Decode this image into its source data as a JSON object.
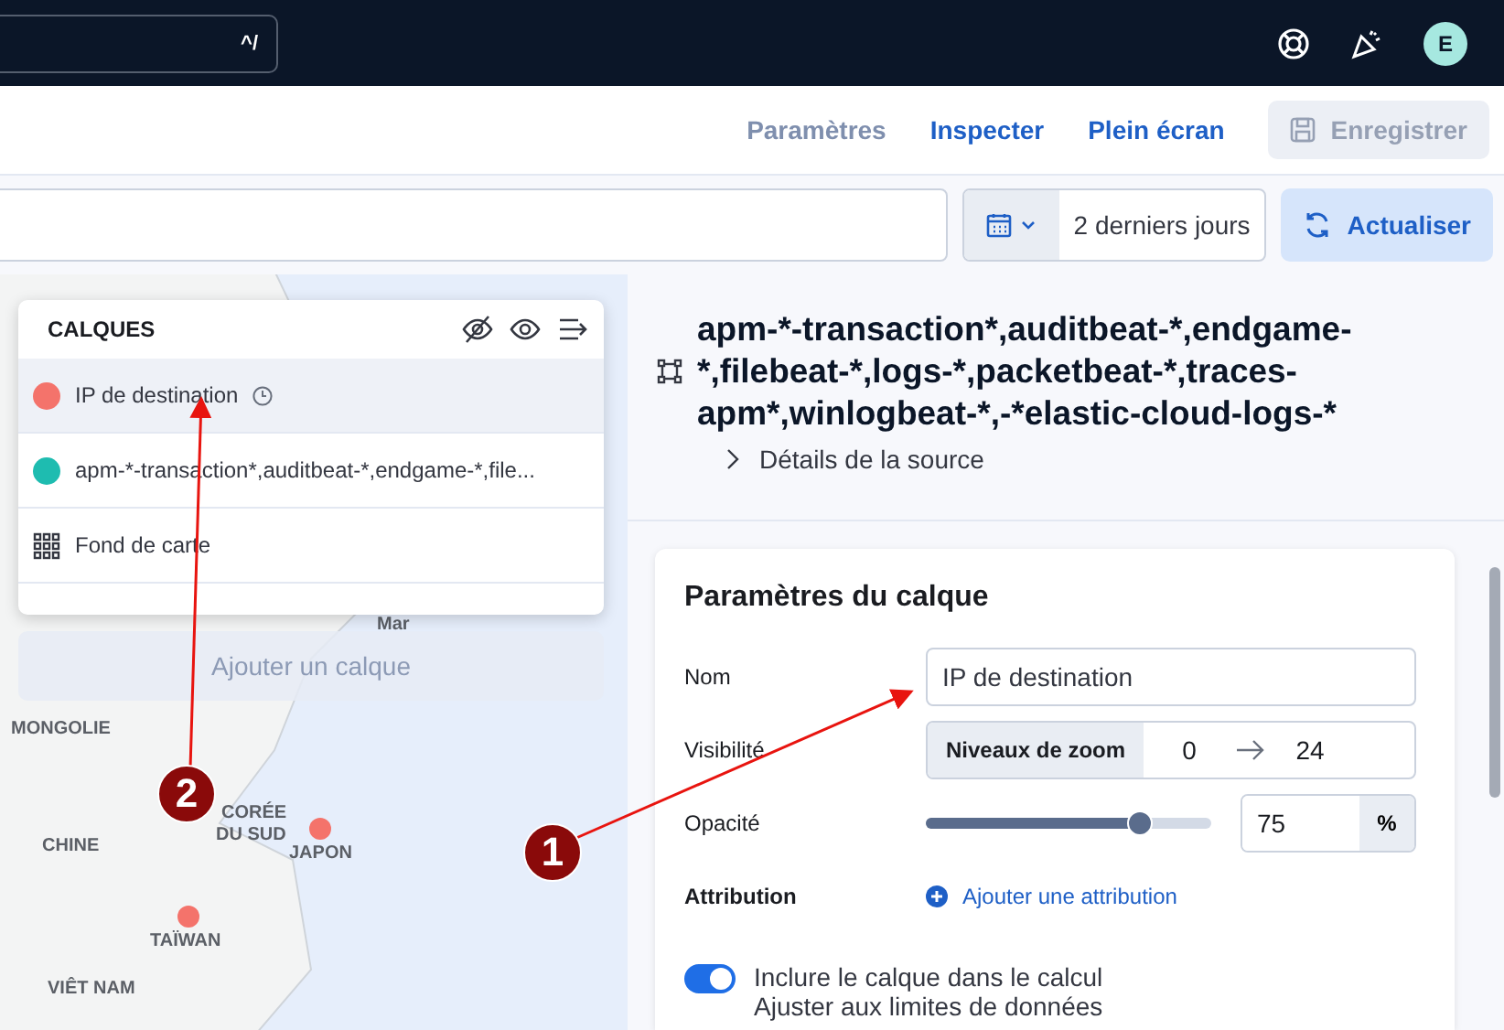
{
  "top_bar": {
    "search_shortcut": "^/",
    "avatar_initial": "E"
  },
  "header": {
    "links": [
      {
        "label": "Paramètres",
        "disabled": true
      },
      {
        "label": "Inspecter",
        "disabled": false
      },
      {
        "label": "Plein écran",
        "disabled": false
      }
    ],
    "save_button": {
      "label": "Enregistrer",
      "disabled": true
    }
  },
  "query_bar": {
    "date_range": "2 derniers jours",
    "refresh_button": "Actualiser"
  },
  "layers_panel": {
    "title": "CALQUES",
    "layers": [
      {
        "kind": "point",
        "name": "IP de destination",
        "color": "#f4736b",
        "selected": true,
        "time_filtered": true
      },
      {
        "kind": "point",
        "name": "apm-*-transaction*,auditbeat-*,endgame-*,file...",
        "color": "#1ebcb0",
        "selected": false,
        "time_filtered": false
      },
      {
        "kind": "basemap",
        "name": "Fond de carte",
        "selected": false,
        "time_filtered": false
      }
    ],
    "add_layer_button": "Ajouter un calque"
  },
  "map": {
    "labels": [
      "Mar",
      "MONGOLIE",
      "CORÉE",
      "DU SUD",
      "CHINE",
      "JAPON",
      "TAÏWAN",
      "VIÊT NAM"
    ]
  },
  "source": {
    "title": "apm-*-transaction*,auditbeat-*,endgame-*,filebeat-*,logs-*,packetbeat-*,traces-apm*,winlogbeat-*,-*elastic-cloud-logs-*",
    "details_toggle": "Détails de la source",
    "expanded": false
  },
  "settings": {
    "title": "Paramètres du calque",
    "name": {
      "label": "Nom",
      "value": "IP de destination"
    },
    "visibility": {
      "label": "Visibilité",
      "prefix": "Niveaux de zoom",
      "min": "0",
      "max": "24"
    },
    "opacity": {
      "label": "Opacité",
      "level": 0.75,
      "value": "75",
      "unit": "%"
    },
    "attribution": {
      "label": "Attribution",
      "action": "Ajouter une attribution"
    },
    "include_switch": {
      "label": "Inclure le calque dans le calcul",
      "on": true
    },
    "fit_label": "Ajuster aux limites de données"
  },
  "annotations": [
    {
      "number": "1"
    },
    {
      "number": "2"
    }
  ]
}
